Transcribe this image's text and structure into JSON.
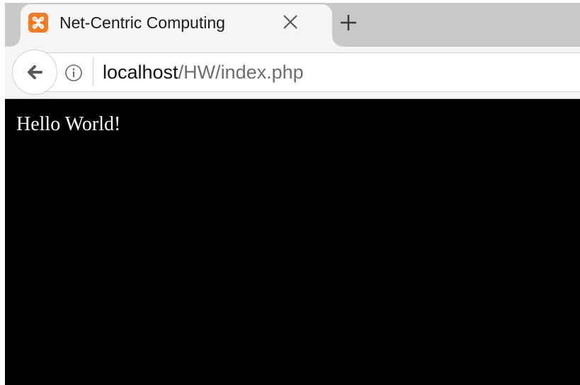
{
  "browser": {
    "tab": {
      "title": "Net-Centric Computing",
      "favicon": "xampp-icon",
      "favicon_color": "#f37b21"
    },
    "new_tab_icon": "plus-icon",
    "close_tab_icon": "close-icon",
    "nav": {
      "back_icon": "back-arrow-icon",
      "info_icon": "info-icon",
      "url_host": "localhost",
      "url_path": "/HW/index.php"
    }
  },
  "page": {
    "background": "#000000",
    "text": "Hello World!",
    "text_color": "#ffffff"
  }
}
